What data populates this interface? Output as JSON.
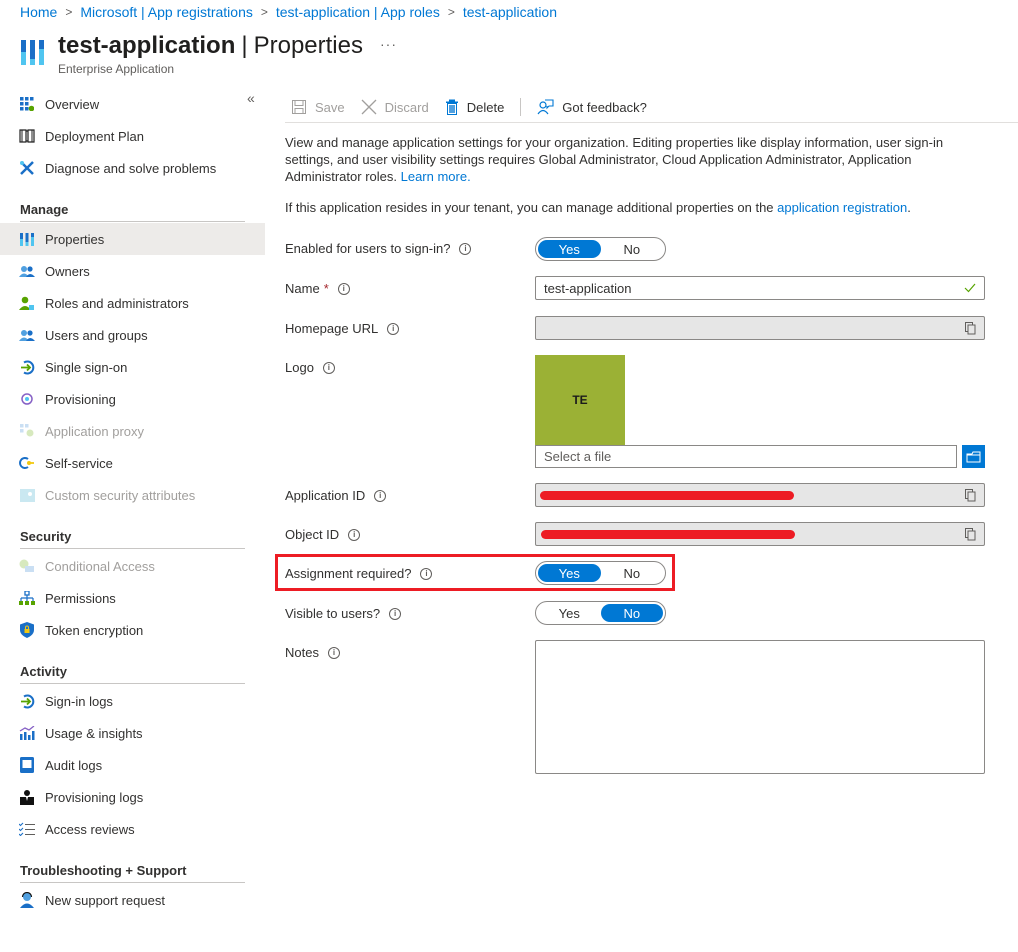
{
  "breadcrumb": [
    "Home",
    "Microsoft | App registrations",
    "test-application | App roles",
    "test-application"
  ],
  "header": {
    "title_bold": "test-application",
    "title_rest": "Properties",
    "subtitle": "Enterprise Application",
    "more_label": "···"
  },
  "sidebar": {
    "collapse_label": "«",
    "groups": [
      {
        "items": [
          {
            "label": "Overview",
            "icon": "overview-icon"
          },
          {
            "label": "Deployment Plan",
            "icon": "book-icon"
          },
          {
            "label": "Diagnose and solve problems",
            "icon": "wrench-icon"
          }
        ]
      },
      {
        "title": "Manage",
        "items": [
          {
            "label": "Properties",
            "icon": "properties-icon",
            "active": true
          },
          {
            "label": "Owners",
            "icon": "users-icon"
          },
          {
            "label": "Roles and administrators",
            "icon": "role-icon"
          },
          {
            "label": "Users and groups",
            "icon": "users-icon"
          },
          {
            "label": "Single sign-on",
            "icon": "sign-in-icon"
          },
          {
            "label": "Provisioning",
            "icon": "provisioning-icon"
          },
          {
            "label": "Application proxy",
            "icon": "app-proxy-icon",
            "disabled": true
          },
          {
            "label": "Self-service",
            "icon": "self-service-icon"
          },
          {
            "label": "Custom security attributes",
            "icon": "attributes-icon",
            "disabled": true
          }
        ]
      },
      {
        "title": "Security",
        "items": [
          {
            "label": "Conditional Access",
            "icon": "conditional-access-icon",
            "disabled": true
          },
          {
            "label": "Permissions",
            "icon": "permissions-icon"
          },
          {
            "label": "Token encryption",
            "icon": "shield-icon"
          }
        ]
      },
      {
        "title": "Activity",
        "items": [
          {
            "label": "Sign-in logs",
            "icon": "sign-in-icon"
          },
          {
            "label": "Usage & insights",
            "icon": "chart-icon"
          },
          {
            "label": "Audit logs",
            "icon": "audit-log-icon"
          },
          {
            "label": "Provisioning logs",
            "icon": "person-icon"
          },
          {
            "label": "Access reviews",
            "icon": "checklist-icon"
          }
        ]
      },
      {
        "title": "Troubleshooting + Support",
        "items": [
          {
            "label": "New support request",
            "icon": "support-icon"
          }
        ]
      }
    ]
  },
  "toolbar": {
    "save_label": "Save",
    "discard_label": "Discard",
    "delete_label": "Delete",
    "feedback_label": "Got feedback?"
  },
  "description": {
    "text": "View and manage application settings for your organization. Editing properties like display information, user sign-in settings, and user visibility settings requires Global Administrator, Cloud Application Administrator, Application Administrator roles.",
    "learn_more": "Learn more.",
    "text2": "If this application resides in your tenant, you can manage additional properties on the",
    "app_reg_link": "application registration",
    "text2_end": "."
  },
  "form": {
    "enabled": {
      "label": "Enabled for users to sign-in?",
      "yes": "Yes",
      "no": "No",
      "value": "Yes"
    },
    "name": {
      "label": "Name",
      "required": "*",
      "value": "test-application"
    },
    "homepage": {
      "label": "Homepage URL",
      "value": ""
    },
    "logo": {
      "label": "Logo",
      "initials": "TE",
      "color": "#9bb135",
      "file_placeholder": "Select a file"
    },
    "app_id": {
      "label": "Application ID",
      "value": "[redacted]"
    },
    "object_id": {
      "label": "Object ID",
      "value": "[redacted]"
    },
    "assignment": {
      "label": "Assignment required?",
      "yes": "Yes",
      "no": "No",
      "value": "Yes"
    },
    "visible": {
      "label": "Visible to users?",
      "yes": "Yes",
      "no": "No",
      "value": "No"
    },
    "notes": {
      "label": "Notes",
      "value": ""
    }
  },
  "colors": {
    "accent": "#0078d4",
    "highlight": "#ed1c24"
  }
}
